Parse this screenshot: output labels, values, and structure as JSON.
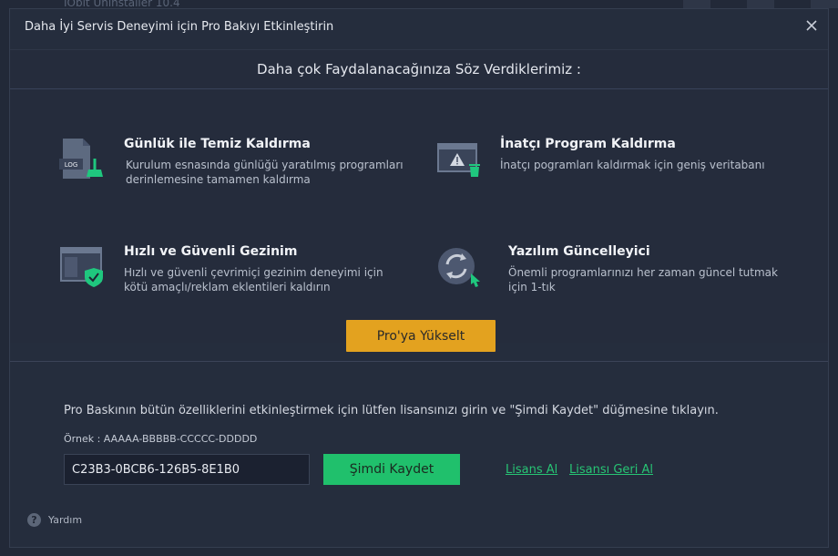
{
  "background_app": {
    "title": "IObit Uninstaller 10.4"
  },
  "dialog": {
    "title": "Daha İyi Servis Deneyimi için Pro Bakıyı Etkinleştirin",
    "close_icon": "close-icon"
  },
  "promo": {
    "header": "Daha çok Faydalanacağınıza Söz Verdiklerimiz :",
    "features": [
      {
        "icon": "log-file-broom-icon",
        "title": "Günlük ile Temiz Kaldırma",
        "description": "Kurulum esnasında günlüğü yaratılmış programları derinlemesine tamamen kaldırma"
      },
      {
        "icon": "stubborn-program-trash-icon",
        "title": "İnatçı Program Kaldırma",
        "description": "İnatçı pogramları kaldırmak için geniş veritabanı"
      },
      {
        "icon": "browser-shield-icon",
        "title": "Hızlı ve Güvenli Gezinim",
        "description": "Hızlı ve güvenli çevrimiçi gezinim deneyimi için kötü amaçlı/reklam eklentileri kaldırın"
      },
      {
        "icon": "refresh-update-icon",
        "title": "Yazılım Güncelleyici",
        "description": "Önemli programlarınızı her zaman güncel tutmak için 1-tık"
      }
    ],
    "upgrade_label": "Pro'ya Yükselt"
  },
  "license": {
    "info_text": "Pro Baskının bütün özelliklerini etkinleştirmek için lütfen lisansınızı girin ve \"Şimdi Kaydet\" düğmesine tıklayın.",
    "example_text": "Örnek : AAAAA-BBBBB-CCCCC-DDDDD",
    "input_value": "C23B3-0BCB6-126B5-8E1B0",
    "register_label": "Şimdi Kaydet",
    "buy_link": "Lisans Al",
    "retrieve_link": "Lisansı Geri Al"
  },
  "help": {
    "label": "Yardım",
    "icon": "question-icon"
  },
  "colors": {
    "upgrade_button": "#e3a21f",
    "register_button": "#20c06c",
    "link": "#27c474",
    "dialog_bg": "#252d3d"
  }
}
